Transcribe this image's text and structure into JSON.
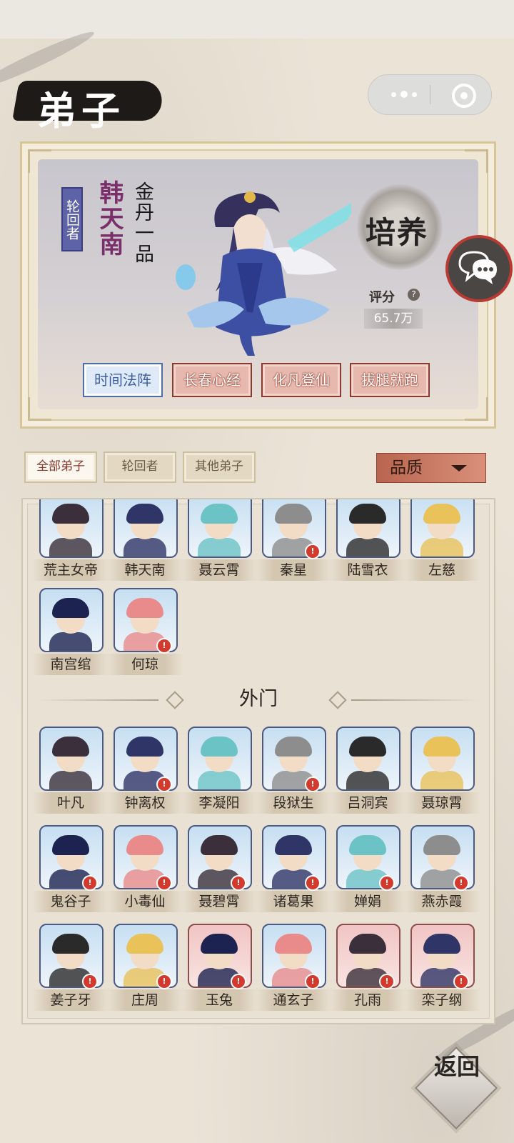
{
  "header": {
    "title": "弟子"
  },
  "capsule": {
    "menu_icon": "more-dots-icon",
    "close_icon": "target-circle-icon"
  },
  "hero": {
    "tag": "轮回者",
    "name": "韩天南",
    "rank": "金丹一品",
    "cultivate_label": "培养",
    "score_label": "评分",
    "score_help": "?",
    "score_value": "65.7万",
    "skills": [
      "时间法阵",
      "长春心经",
      "化凡登仙",
      "拔腿就跑"
    ]
  },
  "filters": {
    "tabs": [
      "全部弟子",
      "轮回者",
      "其他弟子"
    ],
    "active": "全部弟子",
    "sort_label": "品质"
  },
  "disciples_inner": [
    {
      "name": "荒主女帝",
      "alert": false
    },
    {
      "name": "韩天南",
      "alert": false
    },
    {
      "name": "聂云霄",
      "alert": false
    },
    {
      "name": "秦星",
      "alert": true
    },
    {
      "name": "陆雪衣",
      "alert": false
    },
    {
      "name": "左慈",
      "alert": false
    },
    {
      "name": "南宫绾",
      "alert": false
    },
    {
      "name": "何琼",
      "alert": true
    }
  ],
  "section_outer": "外门",
  "disciples_outer": [
    {
      "name": "叶凡",
      "alert": false
    },
    {
      "name": "钟离权",
      "alert": true
    },
    {
      "name": "李凝阳",
      "alert": false
    },
    {
      "name": "段狱生",
      "alert": true
    },
    {
      "name": "吕洞宾",
      "alert": false
    },
    {
      "name": "聂琼霄",
      "alert": false
    },
    {
      "name": "鬼谷子",
      "alert": true
    },
    {
      "name": "小毒仙",
      "alert": true
    },
    {
      "name": "聂碧霄",
      "alert": true
    },
    {
      "name": "诸葛果",
      "alert": true
    },
    {
      "name": "婵娟",
      "alert": true
    },
    {
      "name": "燕赤霞",
      "alert": true
    },
    {
      "name": "姜子牙",
      "alert": true
    },
    {
      "name": "庄周",
      "alert": true
    },
    {
      "name": "玉兔",
      "alert": true
    },
    {
      "name": "通玄子",
      "alert": true
    },
    {
      "name": "孔雨",
      "alert": true
    },
    {
      "name": "栾子纲",
      "alert": true
    }
  ],
  "alert_mark": "!",
  "back_button": {
    "label": "返回"
  },
  "chat_icon": "chat-bubble-icon"
}
